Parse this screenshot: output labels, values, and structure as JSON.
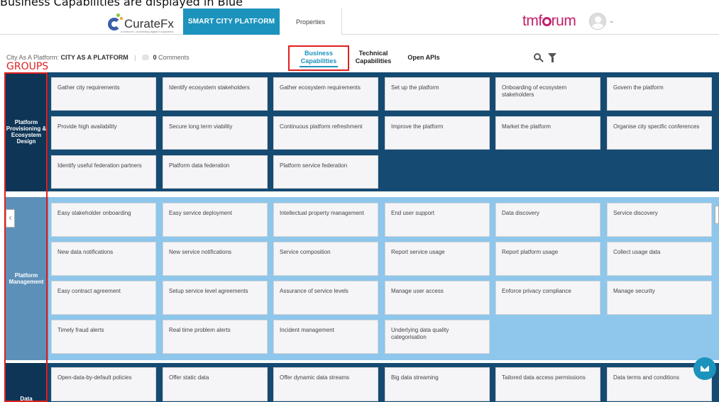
{
  "caption": "Business Capabilities are displayed in Blue",
  "brand": {
    "name": "CurateFx",
    "tagline": "a tmforum | connecting digital ecosystems",
    "partner": "tmforum"
  },
  "nav": {
    "platform": "SMART CITY PLATFORM",
    "properties": "Properties"
  },
  "breadcrumb": {
    "prefix": "City As A Platform:",
    "name": "CITY AS A PLATFORM",
    "comments_count": "0",
    "comments_label": "Comments"
  },
  "tabs": {
    "business_line1": "Business",
    "business_line2": "Capabilities",
    "technical_line1": "Technical",
    "technical_line2": "Capabilities",
    "apis": "Open APIs"
  },
  "annotation": {
    "groups": "GROUPS"
  },
  "colors": {
    "accent": "#1c93bd",
    "dark_section": "#154a72",
    "light_section": "#8ec6ec",
    "highlight": "#e02020"
  },
  "icons": [
    "search-icon",
    "filter-icon",
    "avatar-icon",
    "chevron-down-icon",
    "chevron-left-icon",
    "chat-icon"
  ],
  "groups": [
    {
      "label": "Platform Provisioning & Ecosystem Design",
      "cards": [
        "Gather city requirements",
        "Identify ecosystem stakeholders",
        "Gather ecosystem requirements",
        "Set up the platform",
        "Onboarding of ecosystem stakeholders",
        "Govern the platform",
        "Provide high availability",
        "Secure long term viability",
        "Continuous platform refreshment",
        "Improve the platform",
        "Market the platform",
        "Organise city specific conferences",
        "Identify useful federation partners",
        "Platform data federation",
        "Platform service federation"
      ]
    },
    {
      "label": "Platform Management",
      "cards": [
        "Easy stakeholder onboarding",
        "Easy service deployment",
        "Intellectual property management",
        "End user support",
        "Data discovery",
        "Service discovery",
        "New data notifications",
        "New service notifications",
        "Service composition",
        "Report service usage",
        "Report platform usage",
        "Collect usage data",
        "Easy contract agreement",
        "Setup service level agreements",
        "Assurance of service levels",
        "Manage user access",
        "Enforce privacy compliance",
        "Manage security",
        "Timely fraud alerts",
        "Real time problem alerts",
        "Incident management",
        "Underlying data quality categorisation"
      ]
    },
    {
      "label": "Data Provisioning",
      "cards": [
        "Open-data-by-default policies",
        "Offer static data",
        "Offer dynamic data streams",
        "Big data streaming",
        "Tailored data access permissions",
        "Data terms and conditions"
      ]
    }
  ]
}
